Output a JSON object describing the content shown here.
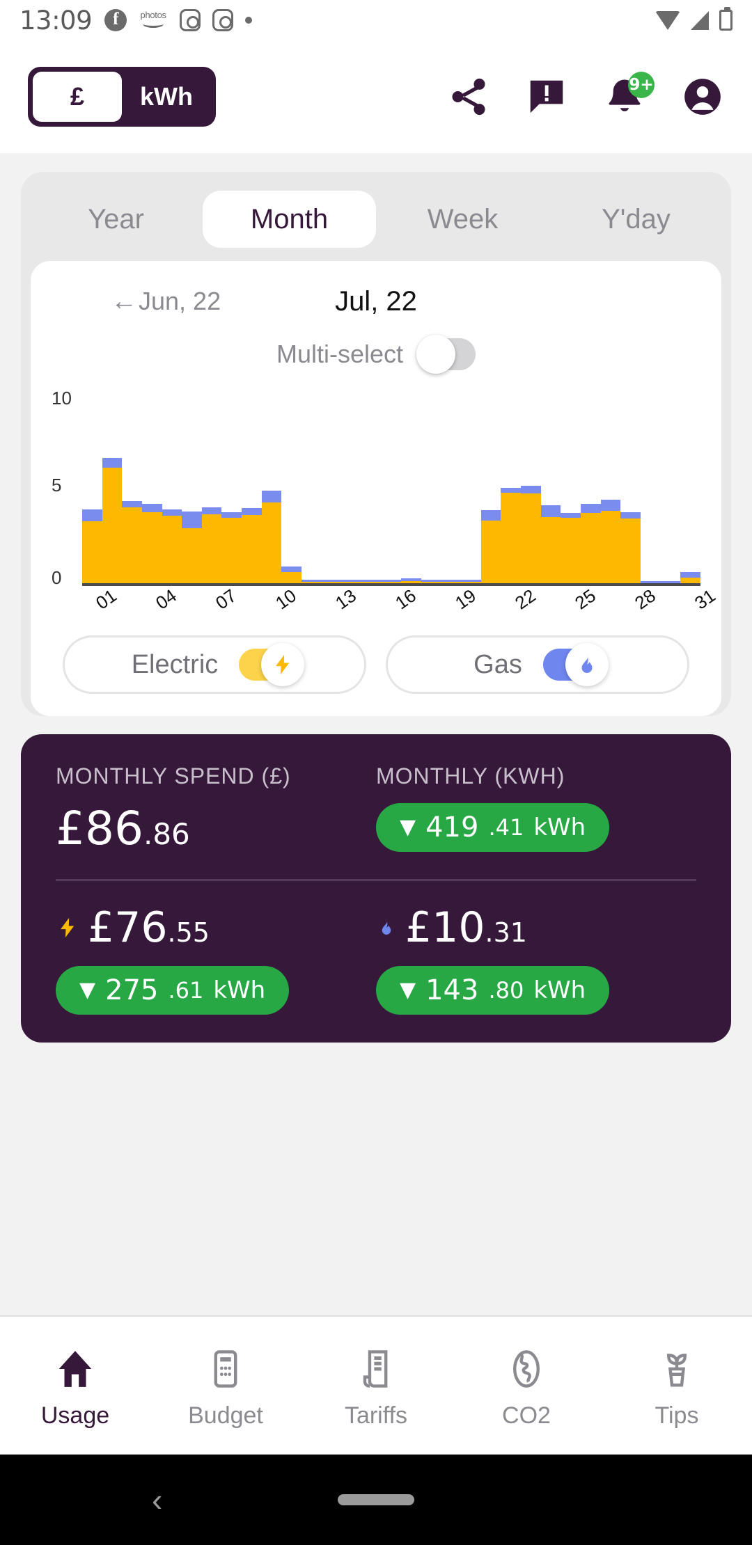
{
  "status_bar": {
    "time": "13:09",
    "left_icons": [
      "facebook-icon",
      "photos-icon",
      "instagram-icon",
      "instagram-icon",
      "dot-icon"
    ],
    "right_icons": [
      "wifi-icon",
      "signal-icon",
      "battery-icon"
    ]
  },
  "header": {
    "unit_toggle": {
      "currency": "£",
      "energy": "kWh",
      "active": "currency"
    },
    "icons": [
      {
        "name": "share-icon"
      },
      {
        "name": "alert-message-icon"
      },
      {
        "name": "notification-bell-icon",
        "badge": "9+"
      },
      {
        "name": "account-avatar-icon"
      }
    ]
  },
  "tabs": [
    {
      "label": "Year",
      "active": false
    },
    {
      "label": "Month",
      "active": true
    },
    {
      "label": "Week",
      "active": false
    },
    {
      "label": "Y'day",
      "active": false
    }
  ],
  "date_nav": {
    "prev_label": "Jun, 22",
    "prev_arrow": "←",
    "current_label": "Jul, 22"
  },
  "multi_select": {
    "label": "Multi-select",
    "enabled": false
  },
  "fuel_toggles": [
    {
      "label": "Electric",
      "enabled": true,
      "icon": "lightning-bolt-icon",
      "color": "#fcb900"
    },
    {
      "label": "Gas",
      "enabled": true,
      "icon": "flame-icon",
      "color": "#6f86ef"
    }
  ],
  "summary": {
    "spend_caption": "MONTHLY SPEND (£)",
    "spend_whole": "£86",
    "spend_dec": ".86",
    "kwh_caption": "MONTHLY (KWH)",
    "kwh_pill": {
      "arrow": "▼",
      "whole": "419",
      "dec": ".41",
      "unit": "kWh",
      "color": "#28a745"
    },
    "electric": {
      "icon": "lightning-bolt-icon",
      "amount_whole": "£76",
      "amount_dec": ".55",
      "pill": {
        "arrow": "▼",
        "whole": "275",
        "dec": ".61",
        "unit": "kWh"
      }
    },
    "gas": {
      "icon": "flame-icon",
      "amount_whole": "£10",
      "amount_dec": ".31",
      "pill": {
        "arrow": "▼",
        "whole": "143",
        "dec": ".80",
        "unit": "kWh"
      }
    }
  },
  "bottom_nav": [
    {
      "label": "Usage",
      "icon": "home-icon",
      "active": true
    },
    {
      "label": "Budget",
      "icon": "calculator-icon",
      "active": false
    },
    {
      "label": "Tariffs",
      "icon": "receipt-icon",
      "active": false
    },
    {
      "label": "CO2",
      "icon": "globe-icon",
      "active": false
    },
    {
      "label": "Tips",
      "icon": "plant-icon",
      "active": false
    }
  ],
  "system_nav": {
    "back": "‹",
    "home_pill": ""
  },
  "chart_data": {
    "type": "bar",
    "stacked": true,
    "title": "",
    "xlabel": "",
    "ylabel": "",
    "ylim": [
      0,
      10
    ],
    "yticks": [
      0,
      5,
      10
    ],
    "ytick_labels": [
      "0",
      "5",
      "10"
    ],
    "grid": false,
    "legend_position": "below-as-toggles",
    "categories": [
      "01",
      "02",
      "03",
      "04",
      "05",
      "06",
      "07",
      "08",
      "09",
      "10",
      "11",
      "12",
      "13",
      "14",
      "15",
      "16",
      "17",
      "18",
      "19",
      "20",
      "21",
      "22",
      "23",
      "24",
      "25",
      "26",
      "27",
      "28",
      "29",
      "30",
      "31"
    ],
    "xtick_labels": [
      "01",
      "04",
      "07",
      "10",
      "13",
      "16",
      "19",
      "22",
      "25",
      "28",
      "31"
    ],
    "series": [
      {
        "name": "Electric",
        "color": "#fcb900",
        "values": [
          3.35,
          6.25,
          4.1,
          3.85,
          3.65,
          3.0,
          3.75,
          3.55,
          3.7,
          4.35,
          0.65,
          0.1,
          0.1,
          0.1,
          0.1,
          0.1,
          0.15,
          0.1,
          0.1,
          0.1,
          3.4,
          4.9,
          4.85,
          3.6,
          3.55,
          3.8,
          3.9,
          3.5,
          0.05,
          0.05,
          0.35
        ]
      },
      {
        "name": "Gas",
        "color": "#7b8cef",
        "values": [
          0.65,
          0.5,
          0.35,
          0.45,
          0.35,
          0.9,
          0.35,
          0.3,
          0.35,
          0.65,
          0.3,
          0.12,
          0.12,
          0.12,
          0.12,
          0.12,
          0.15,
          0.12,
          0.12,
          0.12,
          0.55,
          0.25,
          0.4,
          0.6,
          0.25,
          0.5,
          0.6,
          0.35,
          0.1,
          0.1,
          0.3
        ]
      }
    ]
  }
}
